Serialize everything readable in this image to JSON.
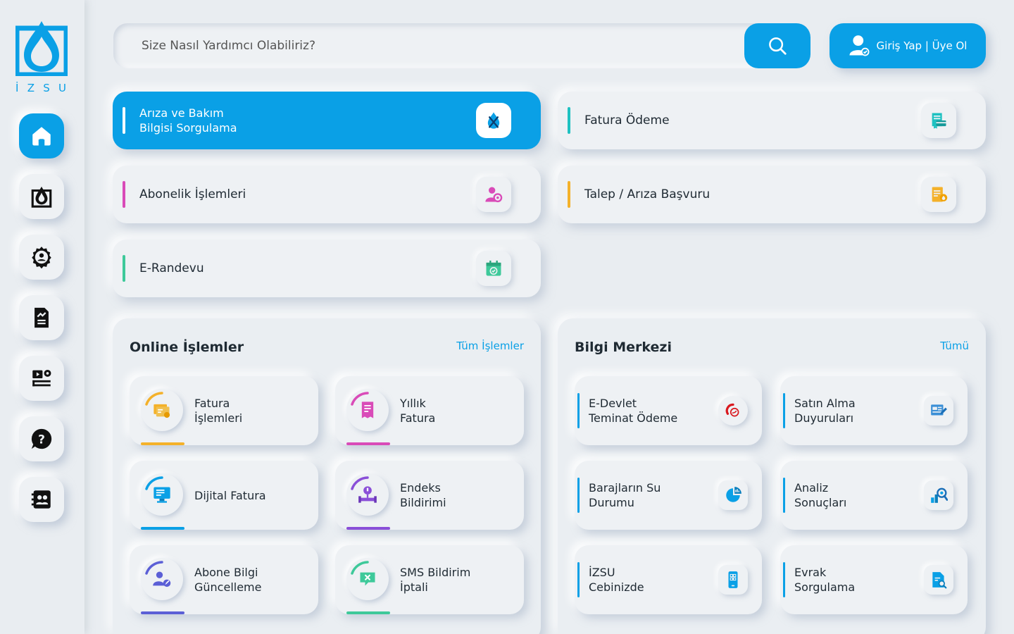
{
  "brand": {
    "letters": [
      "İ",
      "Z",
      "S",
      "U"
    ],
    "accent": "#0aa0e6"
  },
  "search": {
    "placeholder": "Size Nasıl Yardımcı Olabiliriz?"
  },
  "login": {
    "label": "Giriş Yap | Üye Ol"
  },
  "sidebar": [
    {
      "icon": "home-icon",
      "active": true
    },
    {
      "icon": "izsu-drop-icon",
      "active": false
    },
    {
      "icon": "gear-person-icon",
      "active": false
    },
    {
      "icon": "report-icon",
      "active": false
    },
    {
      "icon": "media-icon",
      "active": false
    },
    {
      "icon": "help-icon",
      "active": false
    },
    {
      "icon": "contacts-icon",
      "active": false
    }
  ],
  "quick": [
    {
      "label": "Arıza ve Bakım\nBilgisi Sorgulama",
      "icon": "fault-icon",
      "accent": "#ffffff"
    },
    {
      "label": "Fatura Ödeme",
      "icon": "invoice-pay-icon",
      "accent": "#1ec1c1"
    },
    {
      "label": "Abonelik İşlemleri",
      "icon": "subscriber-icon",
      "accent": "#d94bb8"
    },
    {
      "label": "Talep / Arıza Başvuru",
      "icon": "request-icon",
      "accent": "#f4b12a"
    },
    {
      "label": "E-Randevu",
      "icon": "calendar-icon",
      "accent": "#3ec99a"
    }
  ],
  "online": {
    "title": "Online İşlemler",
    "more": "Tüm İşlemler",
    "items": [
      {
        "label": "Fatura\nİşlemleri",
        "icon": "bills-icon",
        "color": "#f4b12a"
      },
      {
        "label": "Yıllık\nFatura",
        "icon": "yearly-invoice-icon",
        "color": "#d94bb8"
      },
      {
        "label": "Dijital Fatura",
        "icon": "digital-invoice-icon",
        "color": "#0aa0e6"
      },
      {
        "label": "Endeks\nBildirimi",
        "icon": "meter-icon",
        "color": "#8a4fd8"
      },
      {
        "label": "Abone Bilgi\nGüncelleme",
        "icon": "user-edit-icon",
        "color": "#5b5fd6"
      },
      {
        "label": "SMS Bildirim\nİptali",
        "icon": "sms-cancel-icon",
        "color": "#3ec99a"
      }
    ]
  },
  "info": {
    "title": "Bilgi Merkezi",
    "more": "Tümü",
    "items": [
      {
        "label": "E-Devlet\nTeminat Ödeme",
        "icon": "edevlet-icon"
      },
      {
        "label": "Satın Alma\nDuyuruları",
        "icon": "purchase-icon"
      },
      {
        "label": "Barajların Su\nDurumu",
        "icon": "pie-chart-icon"
      },
      {
        "label": "Analiz\nSonuçları",
        "icon": "analysis-icon"
      },
      {
        "label": "İZSU\nCebinizde",
        "icon": "mobile-app-icon"
      },
      {
        "label": "Evrak\nSorgulama",
        "icon": "document-search-icon"
      }
    ]
  }
}
